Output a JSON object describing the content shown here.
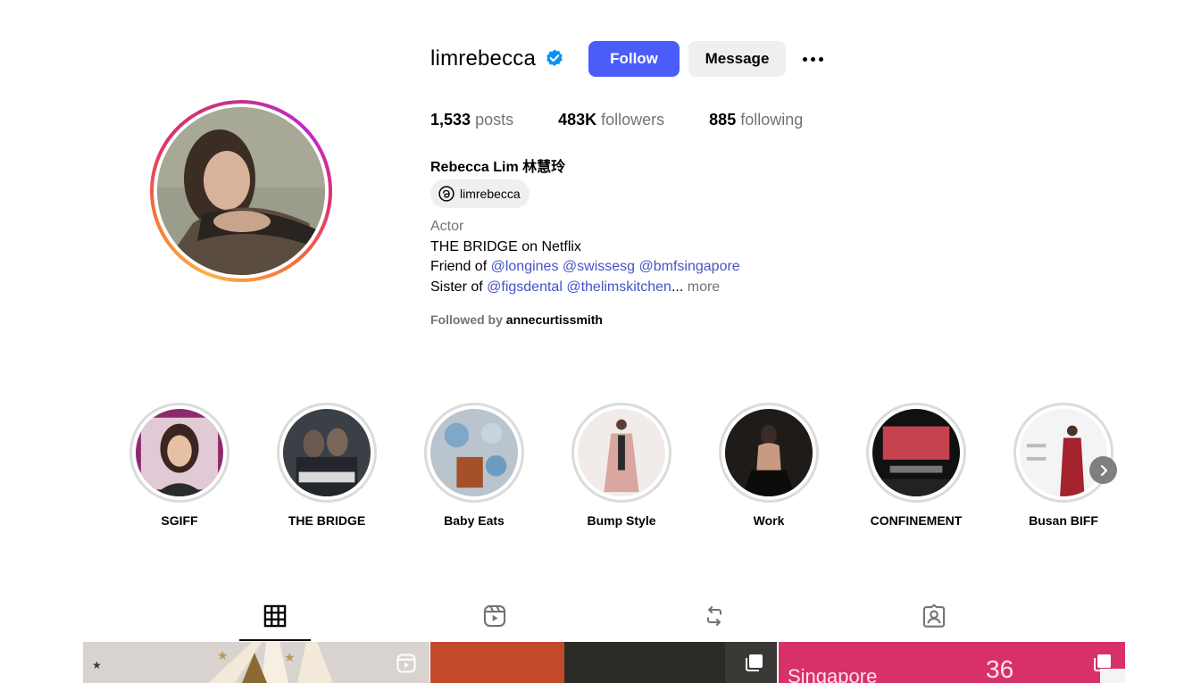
{
  "profile": {
    "username": "limrebecca",
    "verified": true,
    "follow_label": "Follow",
    "message_label": "Message",
    "more_icon": "more-options-icon",
    "stats": {
      "posts_count": "1,533",
      "posts_label": "posts",
      "followers_count": "483K",
      "followers_label": "followers",
      "following_count": "885",
      "following_label": "following"
    },
    "full_name": "Rebecca Lim 林慧玲",
    "threads_handle": "limrebecca",
    "bio": {
      "category": "Actor",
      "line1": "THE BRIDGE on Netflix",
      "line2_prefix": "Friend of",
      "line2_links": [
        "@longines",
        "@swissesg",
        "@bmfsingapore"
      ],
      "line3_prefix": "Sister of",
      "line3_links": [
        "@figsdental",
        "@thelimskitchen"
      ],
      "truncation": "...",
      "more_label": "more"
    },
    "followed_by_prefix": "Followed by",
    "followed_by_user": "annecurtissmith"
  },
  "highlights": [
    {
      "label": "SGIFF"
    },
    {
      "label": "THE BRIDGE"
    },
    {
      "label": "Baby Eats"
    },
    {
      "label": "Bump Style"
    },
    {
      "label": "Work"
    },
    {
      "label": "CONFINEMENT"
    },
    {
      "label": "Busan BIFF"
    }
  ],
  "tabs": [
    {
      "name": "posts",
      "icon": "grid-icon",
      "active": true
    },
    {
      "name": "reels",
      "icon": "reels-icon",
      "active": false
    },
    {
      "name": "reposts",
      "icon": "repost-icon",
      "active": false
    },
    {
      "name": "tagged",
      "icon": "tagged-icon",
      "active": false
    }
  ],
  "colors": {
    "follow_button": "#4a5df9",
    "link": "#4553c7",
    "muted_text": "#737373",
    "verified_badge": "#0095f6"
  }
}
